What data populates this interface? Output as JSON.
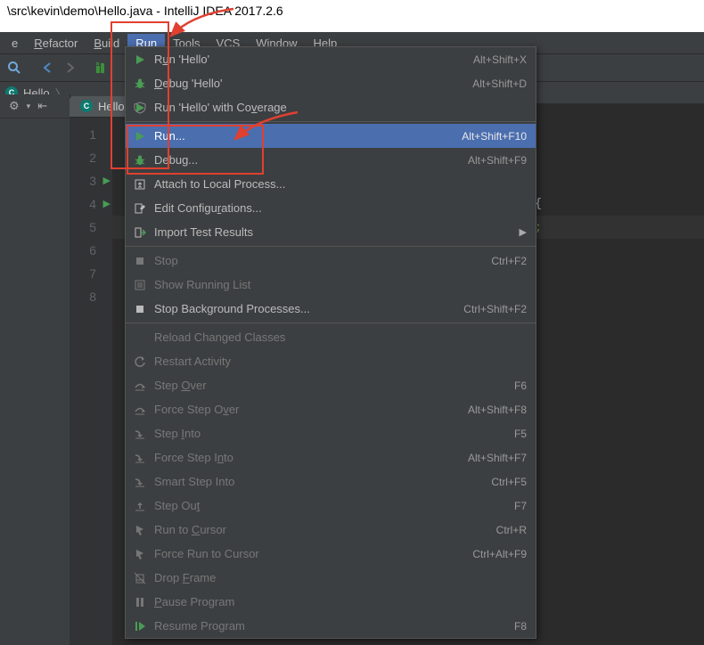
{
  "title": "\\src\\kevin\\demo\\Hello.java - IntelliJ IDEA 2017.2.6",
  "menu": {
    "e": "e",
    "refactor": "Refactor",
    "build": "Build",
    "run": "Run",
    "tools": "Tools",
    "vcs": "VCS",
    "window": "Window",
    "help": "Help"
  },
  "breadcrumb": {
    "file": "Hello"
  },
  "tab": {
    "file": "Hello"
  },
  "gutter": {
    "lines": [
      "1",
      "2",
      "3",
      "4",
      "5",
      "6",
      "7",
      "8"
    ]
  },
  "code": {
    "line4_tail": "rgs){",
    "line5_tail": "d!\");"
  },
  "dropdown": [
    {
      "icon": "play",
      "label_html": "R<span class='ul'>u</span>n 'Hello'",
      "shortcut": "Alt+Shift+X"
    },
    {
      "icon": "bug",
      "label_html": "<span class='ul'>D</span>ebug 'Hello'",
      "shortcut": "Alt+Shift+D"
    },
    {
      "icon": "coverage",
      "label_html": "Run 'Hello' with Co<span class='ul'>v</span>erage",
      "shortcut": ""
    },
    {
      "sep": true
    },
    {
      "icon": "play",
      "label_html": "Run...",
      "shortcut": "Alt+Shift+F10",
      "selected": true
    },
    {
      "icon": "bug",
      "label_html": "Debug...",
      "shortcut": "Alt+Shift+F9"
    },
    {
      "icon": "attach",
      "label_html": "Attach to Local Process...",
      "shortcut": ""
    },
    {
      "icon": "edit",
      "label_html": "Edit Configu<span class='ul'>r</span>ations...",
      "shortcut": ""
    },
    {
      "icon": "import",
      "label_html": "Import Test Results",
      "shortcut": "",
      "submenu": true
    },
    {
      "sep": true
    },
    {
      "icon": "stop",
      "label_html": "Stop",
      "shortcut": "Ctrl+F2",
      "disabled": true
    },
    {
      "icon": "list",
      "label_html": "Show Running List",
      "shortcut": "",
      "disabled": true
    },
    {
      "icon": "stop",
      "label_html": "Stop Background Processes...",
      "shortcut": "Ctrl+Shift+F2"
    },
    {
      "sep": true
    },
    {
      "icon": "",
      "label_html": "Reload Changed Classes",
      "shortcut": "",
      "disabled": true
    },
    {
      "icon": "restart",
      "label_html": "Restart Activity",
      "shortcut": "",
      "disabled": true
    },
    {
      "icon": "stepover",
      "label_html": "Step <span class='ul'>O</span>ver",
      "shortcut": "F6",
      "disabled": true
    },
    {
      "icon": "stepover",
      "label_html": "Force Step O<span class='ul'>v</span>er",
      "shortcut": "Alt+Shift+F8",
      "disabled": true
    },
    {
      "icon": "stepinto",
      "label_html": "Step <span class='ul'>I</span>nto",
      "shortcut": "F5",
      "disabled": true
    },
    {
      "icon": "stepinto",
      "label_html": "Force Step I<span class='ul'>n</span>to",
      "shortcut": "Alt+Shift+F7",
      "disabled": true
    },
    {
      "icon": "stepinto",
      "label_html": "Smart Step Into",
      "shortcut": "Ctrl+F5",
      "disabled": true
    },
    {
      "icon": "stepout",
      "label_html": "Step Ou<span class='ul'>t</span>",
      "shortcut": "F7",
      "disabled": true
    },
    {
      "icon": "cursor",
      "label_html": "Run to <span class='ul'>C</span>ursor",
      "shortcut": "Ctrl+R",
      "disabled": true
    },
    {
      "icon": "cursor",
      "label_html": "Force Run to Cursor",
      "shortcut": "Ctrl+Alt+F9",
      "disabled": true
    },
    {
      "icon": "drop",
      "label_html": "Drop <span class='ul'>F</span>rame",
      "shortcut": "",
      "disabled": true
    },
    {
      "icon": "pause",
      "label_html": "<span class='ul'>P</span>ause Program",
      "shortcut": "",
      "disabled": true
    },
    {
      "icon": "resume",
      "label_html": "Resume Pro<span class='ul'>g</span>ram",
      "shortcut": "F8",
      "disabled": true
    }
  ]
}
